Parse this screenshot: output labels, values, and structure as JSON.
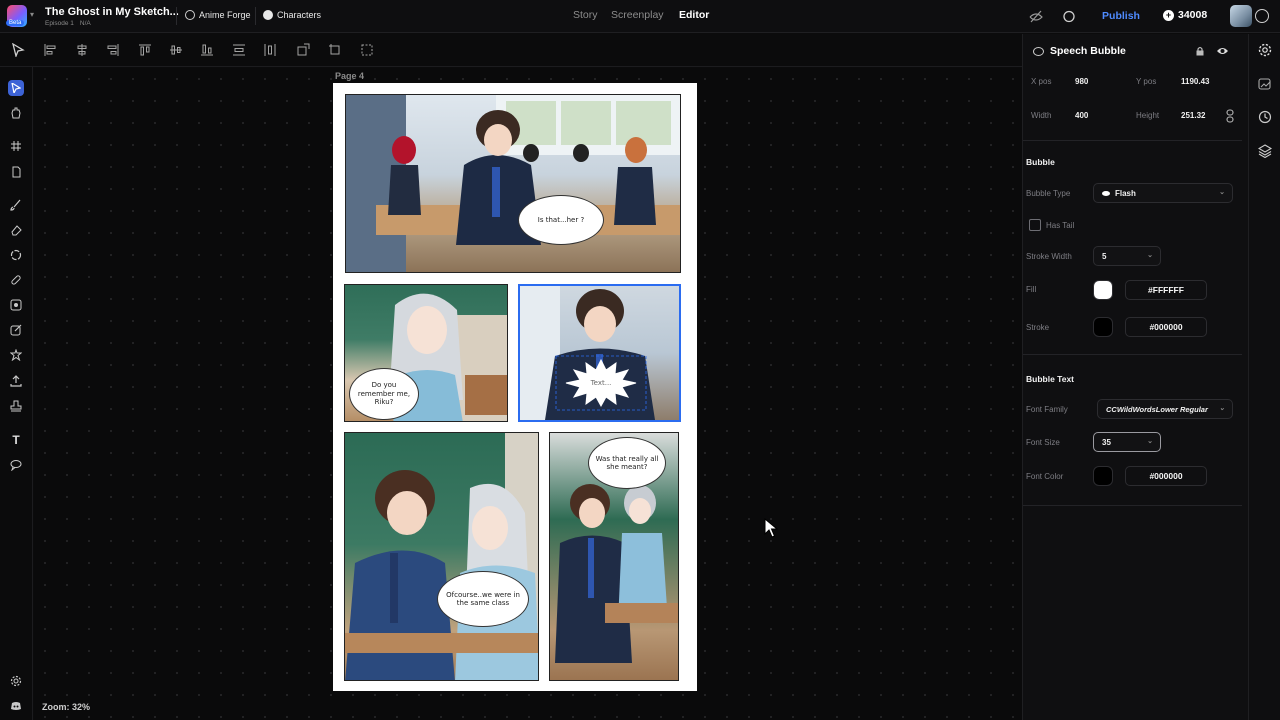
{
  "topbar": {
    "project_title": "The Ghost in My Sketch...",
    "episode": "Episode 1",
    "episode_status": "N/A",
    "beta_label": "Beta",
    "links": {
      "anime_forge": "Anime Forge",
      "characters": "Characters"
    },
    "tabs": {
      "story": "Story",
      "screenplay": "Screenplay",
      "editor": "Editor"
    },
    "publish_label": "Publish",
    "credits": "34008"
  },
  "canvas": {
    "page_label": "Page 4",
    "zoom_label": "Zoom: 32%",
    "panels": [
      {
        "bubble": "Is that...her ?"
      },
      {
        "bubble": "Do you remember me, Riku?"
      },
      {
        "bubble": "Text..."
      },
      {
        "bubble": "Ofcourse..we were in the same class"
      },
      {
        "bubble": "Was that really all she meant?"
      }
    ]
  },
  "inspector": {
    "title": "Speech Bubble",
    "xpos_label": "X pos",
    "xpos_value": "980",
    "ypos_label": "Y pos",
    "ypos_value": "1190.43",
    "width_label": "Width",
    "width_value": "400",
    "height_label": "Height",
    "height_value": "251.32",
    "bubble_section": "Bubble",
    "bubble_type_label": "Bubble Type",
    "bubble_type_value": "Flash",
    "has_tail_label": "Has Tail",
    "stroke_width_label": "Stroke Width",
    "stroke_width_value": "5",
    "fill_label": "Fill",
    "fill_value": "#FFFFFF",
    "stroke_label": "Stroke",
    "stroke_value": "#000000",
    "text_section": "Bubble Text",
    "font_family_label": "Font Family",
    "font_family_value": "CCWildWordsLower Regular",
    "font_size_label": "Font Size",
    "font_size_value": "35",
    "font_color_label": "Font Color",
    "font_color_value": "#000000"
  },
  "colors": {
    "accent": "#2b6cf0",
    "publish": "#4f8bff",
    "background": "#0b0b0c"
  }
}
